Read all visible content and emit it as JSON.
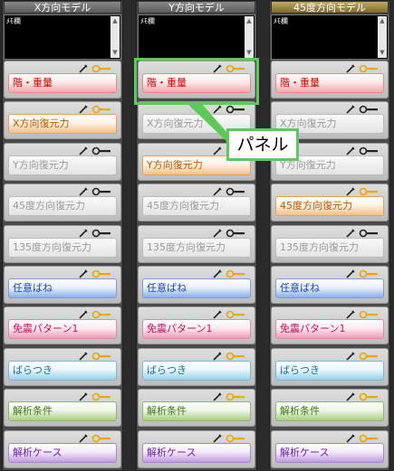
{
  "memo_label": "ﾒﾓ欄",
  "columns": [
    {
      "title": "X方向モデル",
      "panels": [
        {
          "label": "階・重量",
          "style": "red",
          "key_color": "#e8a800"
        },
        {
          "label": "X方向復元力",
          "style": "orange",
          "key_color": "#e8a800"
        },
        {
          "label": "Y方向復元力",
          "style": "gray",
          "key_color": "#222222"
        },
        {
          "label": "45度方向復元力",
          "style": "gray",
          "key_color": "#222222"
        },
        {
          "label": "135度方向復元力",
          "style": "gray",
          "key_color": "#222222"
        },
        {
          "label": "任意ばね",
          "style": "blue",
          "key_color": "#e8a800"
        },
        {
          "label": "免震パターン1",
          "style": "pink",
          "key_color": "#e8a800"
        },
        {
          "label": "ばらつき",
          "style": "cyan",
          "key_color": "#e8a800"
        },
        {
          "label": "解析条件",
          "style": "green",
          "key_color": "#e8a800"
        },
        {
          "label": "解析ケース",
          "style": "purple",
          "key_color": "#e8a800"
        }
      ]
    },
    {
      "title": "Y方向モデル",
      "panels": [
        {
          "label": "階・重量",
          "style": "red",
          "key_color": "#e8a800"
        },
        {
          "label": "X方向復元力",
          "style": "gray",
          "key_color": "#222222"
        },
        {
          "label": "Y方向復元力",
          "style": "orange",
          "key_color": "#e8a800"
        },
        {
          "label": "45度方向復元力",
          "style": "gray",
          "key_color": "#222222"
        },
        {
          "label": "135度方向復元力",
          "style": "gray",
          "key_color": "#222222"
        },
        {
          "label": "任意ばね",
          "style": "blue",
          "key_color": "#e8a800"
        },
        {
          "label": "免震パターン1",
          "style": "pink",
          "key_color": "#e8a800"
        },
        {
          "label": "ばらつき",
          "style": "cyan",
          "key_color": "#e8a800"
        },
        {
          "label": "解析条件",
          "style": "green",
          "key_color": "#e8a800"
        },
        {
          "label": "解析ケース",
          "style": "purple",
          "key_color": "#e8a800"
        }
      ]
    },
    {
      "title": "45度方向モデル",
      "panels": [
        {
          "label": "階・重量",
          "style": "red",
          "key_color": "#e8a800"
        },
        {
          "label": "X方向復元力",
          "style": "gray",
          "key_color": "#222222"
        },
        {
          "label": "Y方向復元力",
          "style": "gray",
          "key_color": "#222222"
        },
        {
          "label": "45度方向復元力",
          "style": "orange",
          "key_color": "#e8a800"
        },
        {
          "label": "135度方向復元力",
          "style": "gray",
          "key_color": "#222222"
        },
        {
          "label": "任意ばね",
          "style": "blue",
          "key_color": "#e8a800"
        },
        {
          "label": "免震パターン1",
          "style": "pink",
          "key_color": "#e8a800"
        },
        {
          "label": "ばらつき",
          "style": "cyan",
          "key_color": "#e8a800"
        },
        {
          "label": "解析条件",
          "style": "green",
          "key_color": "#e8a800"
        },
        {
          "label": "解析ケース",
          "style": "purple",
          "key_color": "#e8a800"
        }
      ]
    }
  ],
  "annotation": {
    "callout_label": "パネル",
    "color": "#5fc85a"
  }
}
